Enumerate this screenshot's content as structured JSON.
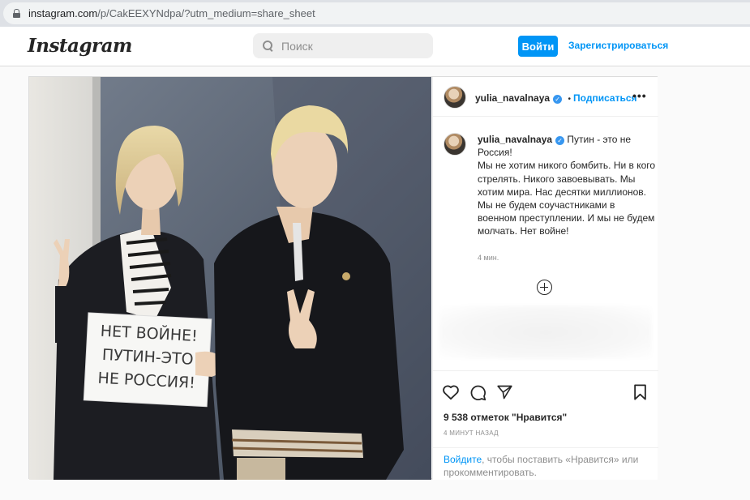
{
  "browser": {
    "url_host": "instagram.com",
    "url_path": "/p/CakEEXYNdpa/?utm_medium=share_sheet"
  },
  "header": {
    "logo": "Instagram",
    "search_placeholder": "Поиск",
    "login_button": "Войти",
    "signup_link": "Зарегистрироваться"
  },
  "post": {
    "author": "yulia_navalnaya",
    "follow_label": "Подписаться",
    "more_label": "•••",
    "caption_text": "Путин - это не Россия!\nМы не хотим никого бомбить. Ни в кого стрелять. Никого завоевывать. Мы хотим мира. Нас десятки миллионов. Мы не будем соучастниками в военном преступлении. И мы не будем молчать. Нет войне!",
    "caption_time": "4 мин.",
    "likes_text": "9 538 отметок \"Нравится\"",
    "time_ago": "4 МИНУТ НАЗАД",
    "login_link": "Войдите",
    "login_rest": ", чтобы поставить «Нравится» или прокомментировать."
  },
  "photo": {
    "sign_line1": "НЕТ ВОЙНЕ!",
    "sign_line2": "ПУТИН-ЭТО",
    "sign_line3": "НЕ РОССИЯ!"
  },
  "colors": {
    "accent": "#0095f6",
    "border": "#dbdbdb",
    "muted": "#8e8e8e"
  },
  "icons": [
    "lock-icon",
    "search-icon",
    "verified-badge-icon",
    "more-icon",
    "plus-circle-icon",
    "heart-icon",
    "comment-icon",
    "share-icon",
    "bookmark-icon"
  ]
}
